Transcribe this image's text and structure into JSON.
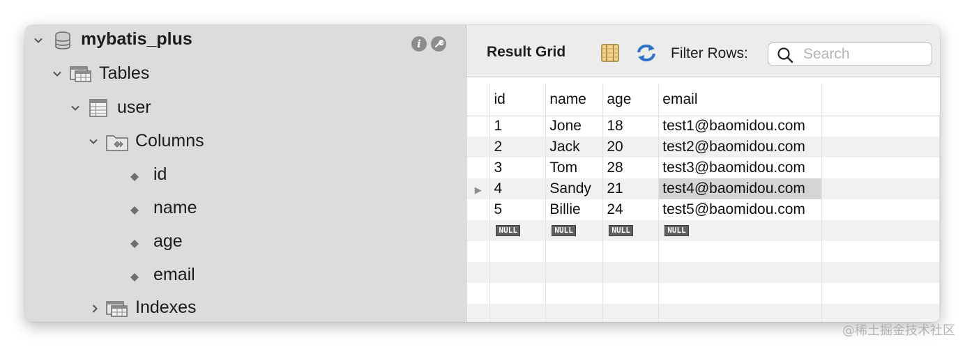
{
  "tree": {
    "schema": {
      "label": "mybatis_plus",
      "icon": "database-icon",
      "expanded": true
    },
    "header_icons": [
      "info-icon",
      "wrench-icon"
    ],
    "tables_group": {
      "label": "Tables",
      "icon": "tables-folder-icon",
      "expanded": true
    },
    "table": {
      "label": "user",
      "icon": "table-icon",
      "expanded": true
    },
    "columns_group": {
      "label": "Columns",
      "icon": "columns-folder-icon",
      "expanded": true
    },
    "columns": [
      {
        "label": "id",
        "icon": "column-diamond-icon"
      },
      {
        "label": "name",
        "icon": "column-diamond-icon"
      },
      {
        "label": "age",
        "icon": "column-diamond-icon"
      },
      {
        "label": "email",
        "icon": "column-diamond-icon"
      }
    ],
    "indexes_group": {
      "label": "Indexes",
      "icon": "indexes-folder-icon",
      "expanded": false
    }
  },
  "toolbar": {
    "title": "Result Grid",
    "icons": [
      "form-editor-icon",
      "refresh-icon"
    ],
    "filter_label": "Filter Rows:",
    "search_placeholder": "Search",
    "search_value": ""
  },
  "grid": {
    "columns": [
      "id",
      "name",
      "age",
      "email"
    ],
    "rows": [
      {
        "id": "1",
        "name": "Jone",
        "age": "18",
        "email": "test1@baomidou.com"
      },
      {
        "id": "2",
        "name": "Jack",
        "age": "20",
        "email": "test2@baomidou.com"
      },
      {
        "id": "3",
        "name": "Tom",
        "age": "28",
        "email": "test3@baomidou.com"
      },
      {
        "id": "4",
        "name": "Sandy",
        "age": "21",
        "email": "test4@baomidou.com"
      },
      {
        "id": "5",
        "name": "Billie",
        "age": "24",
        "email": "test5@baomidou.com"
      }
    ],
    "new_row": [
      "NULL",
      "NULL",
      "NULL",
      "NULL"
    ],
    "current_row_marker": "▶",
    "colors": {
      "null_badge": "#606060",
      "selected_cell": "#d5d5d5",
      "alt_row": "#f1f1f1"
    }
  },
  "watermark": "@稀土掘金技术社区"
}
